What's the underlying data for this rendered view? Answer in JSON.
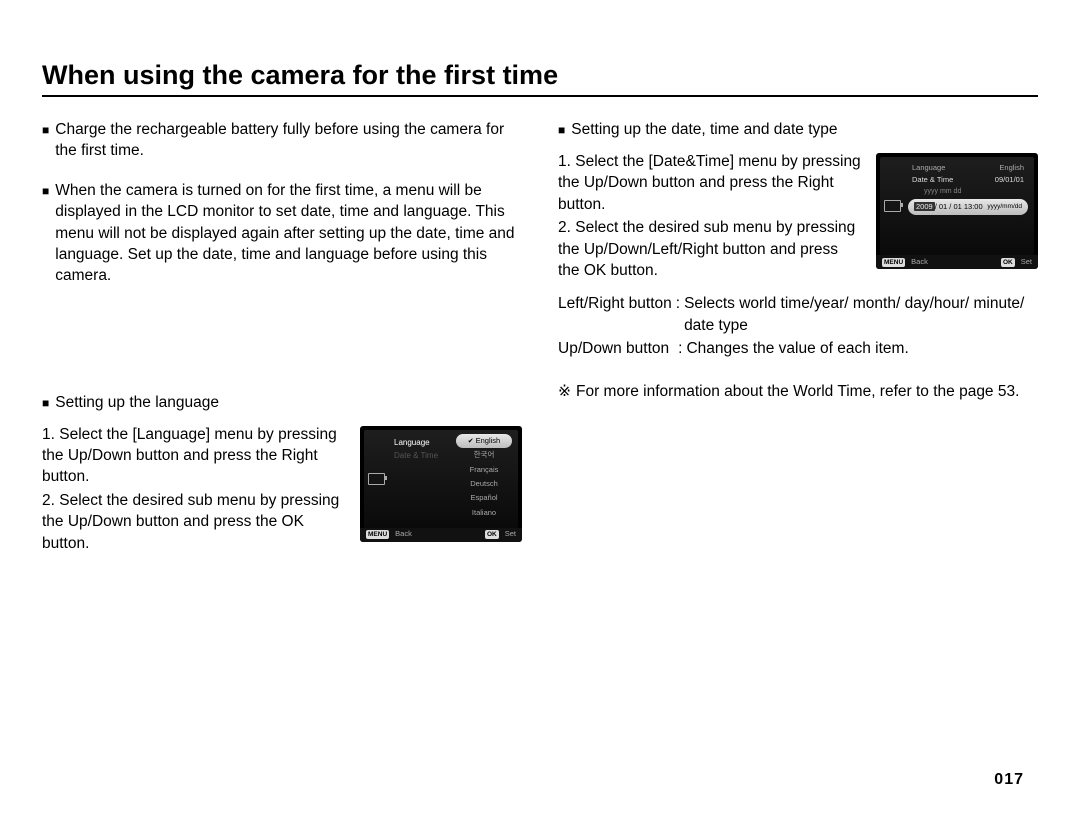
{
  "title": "When using the camera for the first time",
  "page_number": "017",
  "left": {
    "bullets": [
      "Charge the rechargeable battery fully before using the camera for the first time.",
      "When the camera is turned on for the first time, a menu will be displayed in the LCD monitor to set date, time and language. This menu will not be displayed again after setting up the date, time and language. Set up the date, time and language before using this camera."
    ],
    "subheading": "Setting up the language",
    "steps": [
      "1. Select the [Language] menu by pressing the Up/Down button and press the Right button.",
      "2. Select the desired sub menu by pressing the Up/Down button and press the OK button."
    ],
    "lcd": {
      "menu_items": [
        {
          "label": "Language",
          "value": "",
          "sel": true
        },
        {
          "label": "Date & Time",
          "value": "",
          "sel": false
        }
      ],
      "lang_options": [
        "English",
        "한국어",
        "Français",
        "Deutsch",
        "Español",
        "Italiano"
      ],
      "lang_selected": "English",
      "footer_back_tag": "MENU",
      "footer_back": "Back",
      "footer_set_tag": "OK",
      "footer_set": "Set"
    }
  },
  "right": {
    "subheading": "Setting up the date, time and date type",
    "steps": [
      "1. Select the [Date&Time] menu by pressing the Up/Down button and press the Right button.",
      "2. Select the desired sub menu by pressing the Up/Down/Left/Right button and press the OK button."
    ],
    "defs": [
      {
        "label": "Left/Right button",
        "value": "Selects world time/year/ month/ day/hour/ minute/ date type"
      },
      {
        "label": "Up/Down button",
        "value": "Changes the value of each item."
      }
    ],
    "note_symbol": "※",
    "note": "For more information about the World Time, refer to the page 53.",
    "lcd": {
      "row_lang": {
        "label": "Language",
        "value": "English"
      },
      "row_dt": {
        "label": "Date & Time",
        "value": "09/01/01"
      },
      "row_fmt": "yyyy mm dd",
      "date_box": {
        "year": "2009",
        "rest": "/ 01 / 01   13:00",
        "type": "yyyy/mm/dd"
      },
      "footer_back_tag": "MENU",
      "footer_back": "Back",
      "footer_set_tag": "OK",
      "footer_set": "Set"
    }
  }
}
